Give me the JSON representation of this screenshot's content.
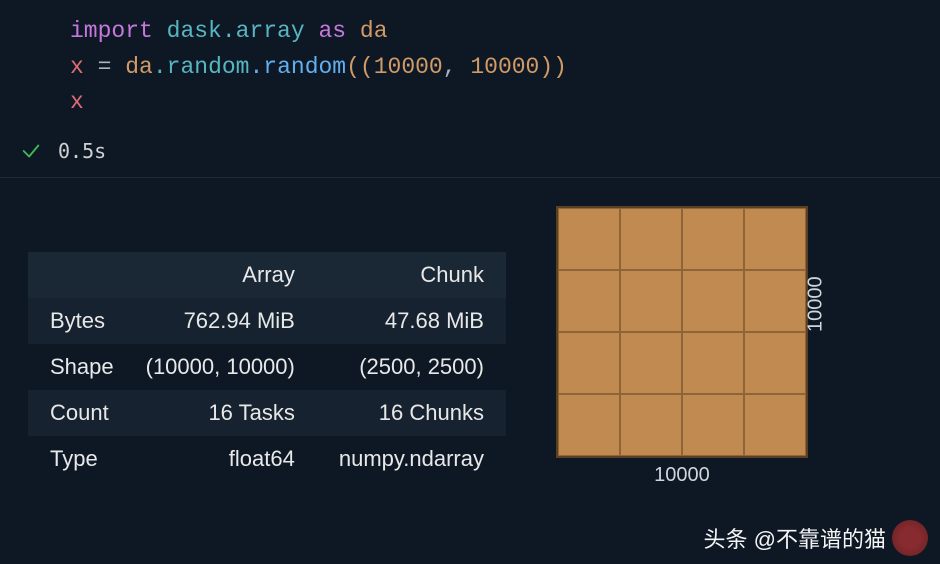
{
  "code": {
    "line1": {
      "import": "import",
      "module": "dask.array",
      "as": "as",
      "alias": "da"
    },
    "line2": {
      "var": "x",
      "op": "=",
      "obj": "da",
      "mod": ".random",
      "method": ".random",
      "args_open": "((",
      "arg1": "10000",
      "comma": ", ",
      "arg2": "10000",
      "args_close": "))"
    },
    "line3": {
      "var": "x"
    }
  },
  "status": {
    "time": "0.5s"
  },
  "table": {
    "headers": {
      "c0": "",
      "c1": "Array",
      "c2": "Chunk"
    },
    "rows": [
      {
        "label": "Bytes",
        "array": "762.94 MiB",
        "chunk": "47.68 MiB"
      },
      {
        "label": "Shape",
        "array": "(10000, 10000)",
        "chunk": "(2500, 2500)"
      },
      {
        "label": "Count",
        "array": "16 Tasks",
        "chunk": "16 Chunks"
      },
      {
        "label": "Type",
        "array": "float64",
        "chunk": "numpy.ndarray"
      }
    ]
  },
  "viz": {
    "xlabel": "10000",
    "ylabel": "10000"
  },
  "watermark": {
    "text": "头条 @不靠谱的猫"
  }
}
